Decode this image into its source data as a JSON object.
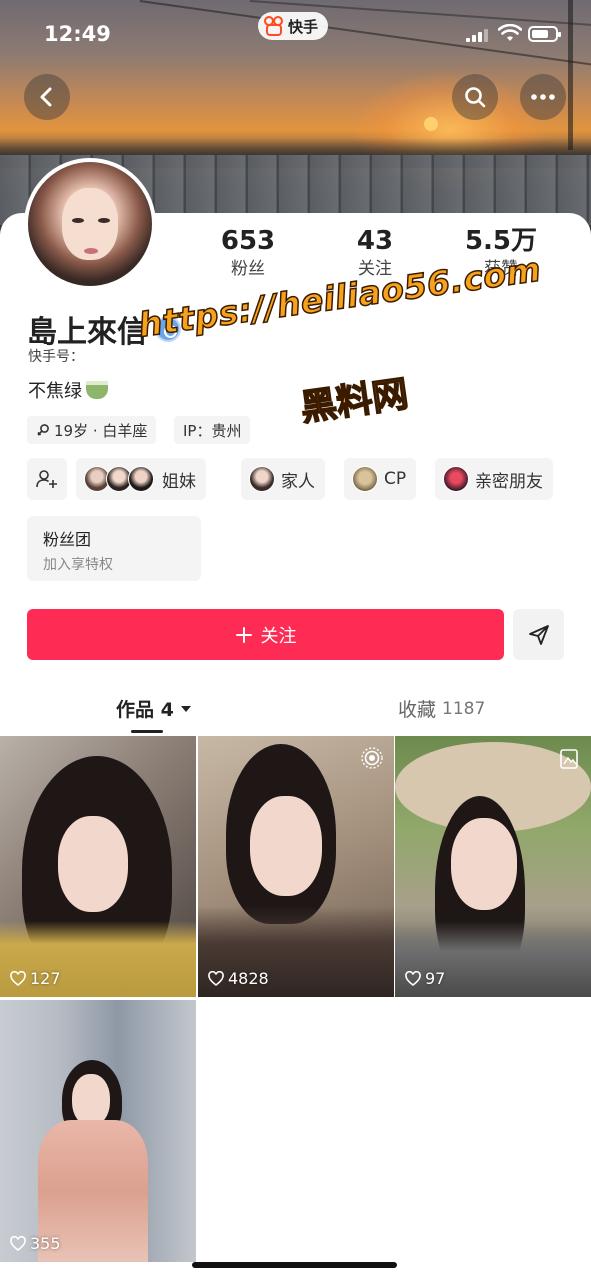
{
  "status_bar": {
    "time": "12:49",
    "app_name": "快手"
  },
  "header": {
    "back_icon": "chevron-left-icon",
    "search_icon": "search-icon",
    "more_icon": "more-icon"
  },
  "stats": [
    {
      "value": "653",
      "label": "粉丝"
    },
    {
      "value": "43",
      "label": "关注"
    },
    {
      "value": "5.5万",
      "label": "获赞"
    }
  ],
  "profile": {
    "name": "島上來信",
    "id_label": "快手号：",
    "bio": "不焦绿",
    "tags": [
      "19岁 · 白羊座",
      "IP：贵州"
    ]
  },
  "relations": [
    {
      "label": "姐妹"
    },
    {
      "label": "家人"
    },
    {
      "label": "CP"
    },
    {
      "label": "亲密朋友"
    }
  ],
  "fans_club": {
    "title": "粉丝团",
    "subtitle": "加入享特权"
  },
  "actions": {
    "follow_label": "关注"
  },
  "tabs": {
    "works_label": "作品 4",
    "favorites_label": "收藏",
    "favorites_count": "1187"
  },
  "posts": [
    {
      "likes": "127"
    },
    {
      "likes": "4828"
    },
    {
      "likes": "97"
    },
    {
      "likes": "355"
    }
  ],
  "watermark": {
    "url": "https://heiliao56.com",
    "text": "黑料网"
  },
  "colors": {
    "accent": "#fe2c55",
    "watermark": "#f6a21c"
  }
}
